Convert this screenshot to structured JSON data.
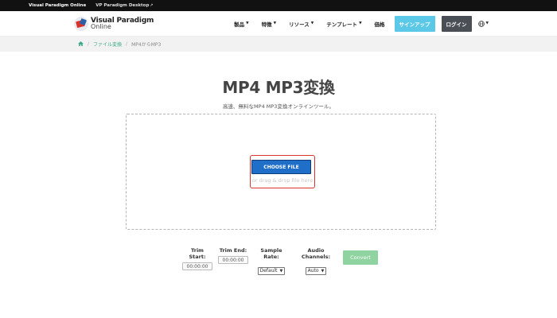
{
  "topbar": {
    "brand": "Visual Paradigm Online",
    "desktop_link": "VP Paradigm Desktop",
    "ext_icon": "external-link-icon"
  },
  "header": {
    "logo_line1": "Visual Paradigm",
    "logo_line2": "Online",
    "nav": {
      "products": "製品",
      "features": "特徴",
      "resources": "リソース",
      "templates": "テンプレート",
      "pricing": "価格"
    },
    "signup": "サインアップ",
    "login": "ログイン",
    "globe_icon": "globe-icon"
  },
  "breadcrumb": {
    "home_icon": "home-icon",
    "file_conversion": "ファイル変換",
    "current": "MP4からMP3"
  },
  "main": {
    "title": "MP4 MP3変換",
    "subtitle": "高速、無料なMP4 MP3変換オンラインツール。",
    "choose_file": "CHOOSE FILE",
    "drag_text": "or drag & drop file here"
  },
  "options": {
    "trim_start_label": "Trim Start:",
    "trim_start_value": "00:00:00",
    "trim_end_label": "Trim End:",
    "trim_end_value": "00:00:00",
    "sample_rate_label": "Sample Rate:",
    "sample_rate_value": "Default",
    "channels_label": "Audio Channels:",
    "channels_value": "Auto",
    "convert": "Convert"
  },
  "colors": {
    "accent_teal": "#3caa8a",
    "signup_bg": "#5bc8e8",
    "login_bg": "#4a4f55",
    "choose_btn": "#1f6fc9",
    "highlight_red": "#d9342b",
    "convert_btn": "#8fd3a0"
  }
}
